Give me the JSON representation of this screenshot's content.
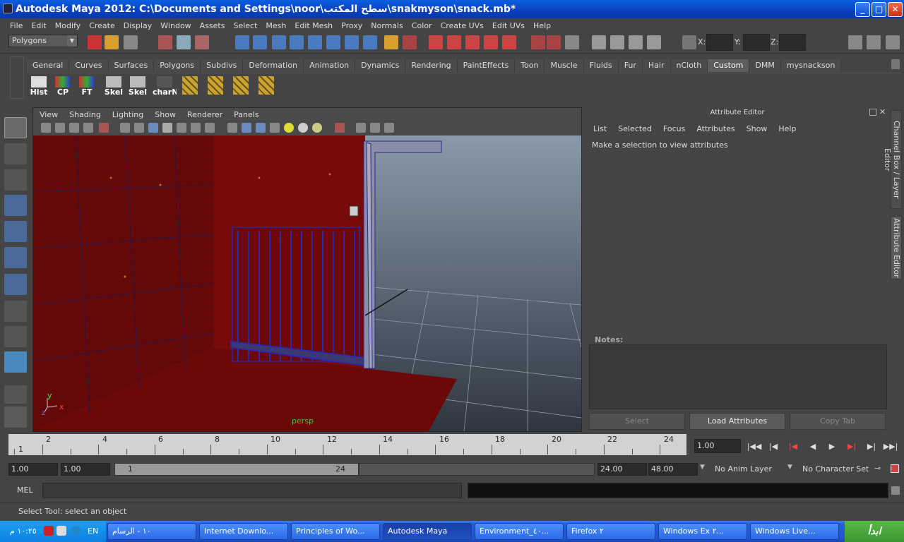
{
  "window": {
    "title": "Autodesk Maya 2012: C:\\Documents and Settings\\noor\\سطح المكتب\\snakmyson\\snack.mb*",
    "minimize": "_",
    "maximize": "□",
    "close": "✕"
  },
  "menubar": [
    "File",
    "Edit",
    "Modify",
    "Create",
    "Display",
    "Window",
    "Assets",
    "Select",
    "Mesh",
    "Edit Mesh",
    "Proxy",
    "Normals",
    "Color",
    "Create UVs",
    "Edit UVs",
    "Help"
  ],
  "toolbar": {
    "mode": "Polygons",
    "x_label": "X:",
    "y_label": "Y:",
    "z_label": "Z:"
  },
  "shelf": {
    "tabs": [
      "General",
      "Curves",
      "Surfaces",
      "Polygons",
      "Subdivs",
      "Deformation",
      "Animation",
      "Dynamics",
      "Rendering",
      "PaintEffects",
      "Toon",
      "Muscle",
      "Fluids",
      "Fur",
      "Hair",
      "nCloth",
      "Custom",
      "DMM",
      "mysnackson"
    ],
    "active_tab": "Custom",
    "buttons": [
      "Hist",
      "CP",
      "FT",
      "Skel",
      "Skel",
      "charN",
      "",
      "",
      "",
      ""
    ]
  },
  "viewport": {
    "menu": [
      "View",
      "Shading",
      "Lighting",
      "Show",
      "Renderer",
      "Panels"
    ],
    "camera_label": "persp",
    "axis": {
      "y": "y",
      "x": "x",
      "z": "z"
    }
  },
  "attribute_editor": {
    "title": "Attribute Editor",
    "menu": [
      "List",
      "Selected",
      "Focus",
      "Attributes",
      "Show",
      "Help"
    ],
    "message": "Make a selection to view attributes",
    "notes_label": "Notes:",
    "buttons": {
      "select": "Select",
      "load": "Load Attributes",
      "copy": "Copy Tab"
    }
  },
  "side_tabs": {
    "channel_box": "Channel Box / Layer Editor",
    "attribute_editor": "Attribute Editor"
  },
  "timeline": {
    "ticks": [
      "2",
      "4",
      "6",
      "8",
      "10",
      "12",
      "14",
      "16",
      "18",
      "20",
      "22",
      "24"
    ],
    "start_label": "1",
    "current_frame": "1.00"
  },
  "range": {
    "start": "1.00",
    "playback_start": "1.00",
    "slider_start": "1",
    "slider_end": "24",
    "playback_end": "24.00",
    "end": "48.00",
    "anim_layer": "No Anim Layer",
    "character_set": "No Character Set"
  },
  "command_line": {
    "label": "MEL"
  },
  "help_line": "Select Tool: select an object",
  "taskbar": {
    "start": "ابدأ",
    "clock": "١٠:٢٥ م",
    "lang": "EN",
    "tasks": [
      "١٠ - الرسام",
      "Internet Downlo...",
      "Principles of Wo...",
      "Autodesk Maya",
      "Environment_٤٠...",
      "Firefox ٢",
      "Windows Ex ٢...",
      "Windows Live..."
    ]
  }
}
